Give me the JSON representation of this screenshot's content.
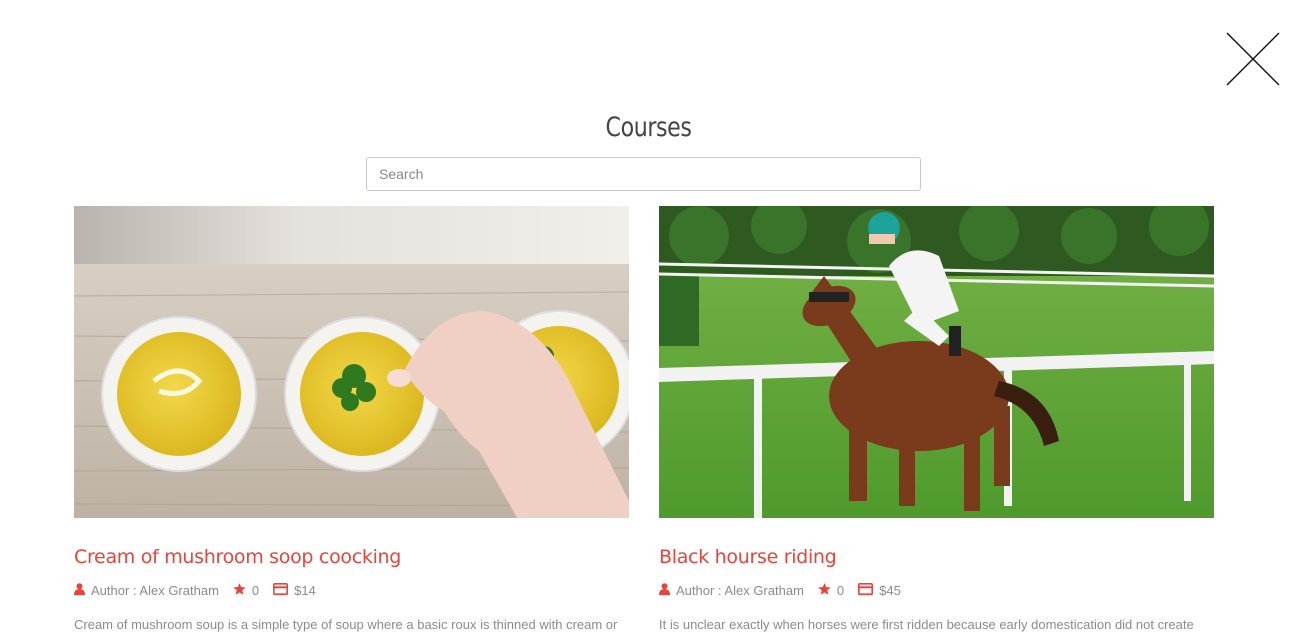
{
  "page_title": "Courses",
  "search": {
    "placeholder": "Search"
  },
  "courses": [
    {
      "title": "Cream of mushroom soop coocking",
      "author": "Author : Alex Gratham",
      "rating": "0",
      "price": "$14",
      "description": "Cream of mushroom soup is a simple type of soup where a basic roux is thinned with cream or",
      "image_subject": "three bowls of yellow soup garnished with parsley on a wooden table"
    },
    {
      "title": "Black hourse riding",
      "author": "Author : Alex Gratham",
      "rating": "0",
      "price": "$45",
      "description": "It is unclear exactly when horses were first ridden because early domestication did not create",
      "image_subject": "jockey riding a brown racehorse on a grass track"
    }
  ],
  "colors": {
    "accent": "#e8443a",
    "muted_text": "#8b8b8b",
    "title_text": "#444444"
  }
}
